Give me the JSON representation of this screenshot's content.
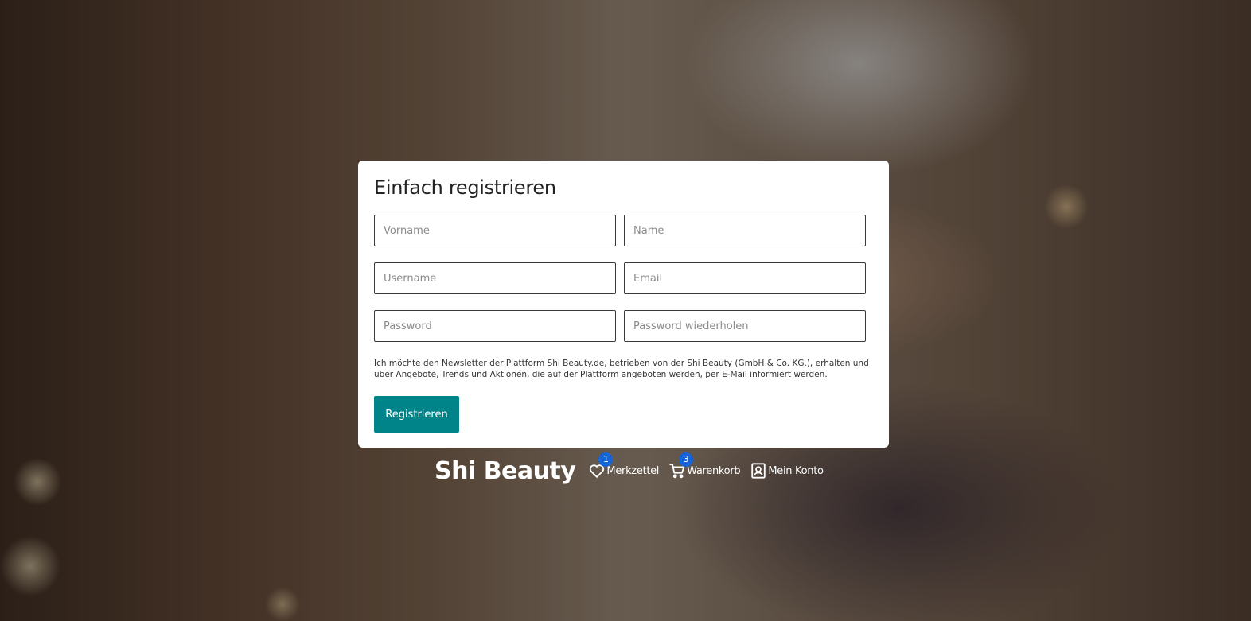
{
  "form": {
    "title": "Einfach registrieren",
    "fields": {
      "vorname": {
        "placeholder": "Vorname",
        "value": ""
      },
      "name": {
        "placeholder": "Name",
        "value": ""
      },
      "username": {
        "placeholder": "Username",
        "value": ""
      },
      "email": {
        "placeholder": "Email",
        "value": ""
      },
      "password": {
        "placeholder": "Password",
        "value": ""
      },
      "password_repeat": {
        "placeholder": "Password wiederholen",
        "value": ""
      }
    },
    "newsletter_text": "Ich möchte den Newsletter der Plattform Shi Beauty.de, betrieben von der Shi Beauty (GmbH & Co. KG.), erhalten und über Angebote, Trends und Aktionen, die auf der Plattform angeboten werden, per E-Mail informiert werden.",
    "submit_label": "Registrieren",
    "accent_color": "#00848a"
  },
  "footer": {
    "brand": "Shi Beauty",
    "links": {
      "wishlist": {
        "label": "Merkzettel",
        "badge": "1",
        "icon": "heart-icon"
      },
      "cart": {
        "label": "Warenkorb",
        "badge": "3",
        "icon": "cart-icon"
      },
      "account": {
        "label": "Mein Konto",
        "icon": "user-icon"
      }
    },
    "badge_color": "#1565d8"
  }
}
